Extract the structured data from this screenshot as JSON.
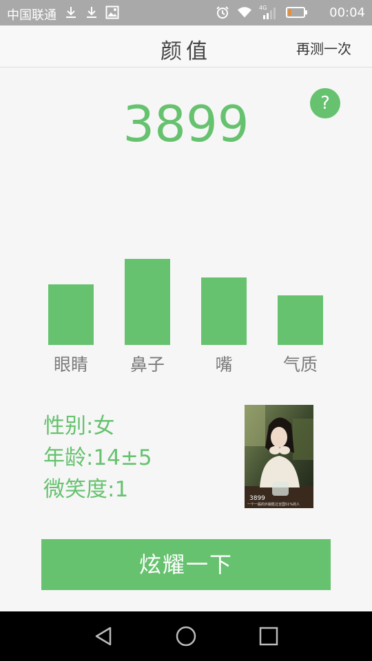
{
  "status_bar": {
    "carrier": "中国联通",
    "time": "00:04",
    "network": "4G",
    "icons_left": [
      "download-icon",
      "download-icon",
      "image-icon"
    ],
    "icons_right": [
      "alarm-icon",
      "wifi-icon",
      "signal-icon",
      "battery-icon"
    ]
  },
  "header": {
    "title": "颜值",
    "retest_label": "再测一次"
  },
  "score": "3899",
  "help_label": "?",
  "chart_data": {
    "type": "bar",
    "categories": [
      "眼睛",
      "鼻子",
      "嘴",
      "气质"
    ],
    "values": [
      88,
      125,
      98,
      72
    ],
    "ylim": [
      0,
      130
    ],
    "grid": false,
    "color": "#66c26f"
  },
  "result": {
    "gender": "性别:女",
    "age": "年龄:14±5",
    "smile": "微笑度:1"
  },
  "photo": {
    "score": "3899",
    "caption": "一个一般的外貌胜过全国51%的人"
  },
  "share_label": "炫耀一下",
  "colors": {
    "accent": "#66c26f",
    "status_bar": "#a9a9a9",
    "nav_bar": "#000000"
  }
}
